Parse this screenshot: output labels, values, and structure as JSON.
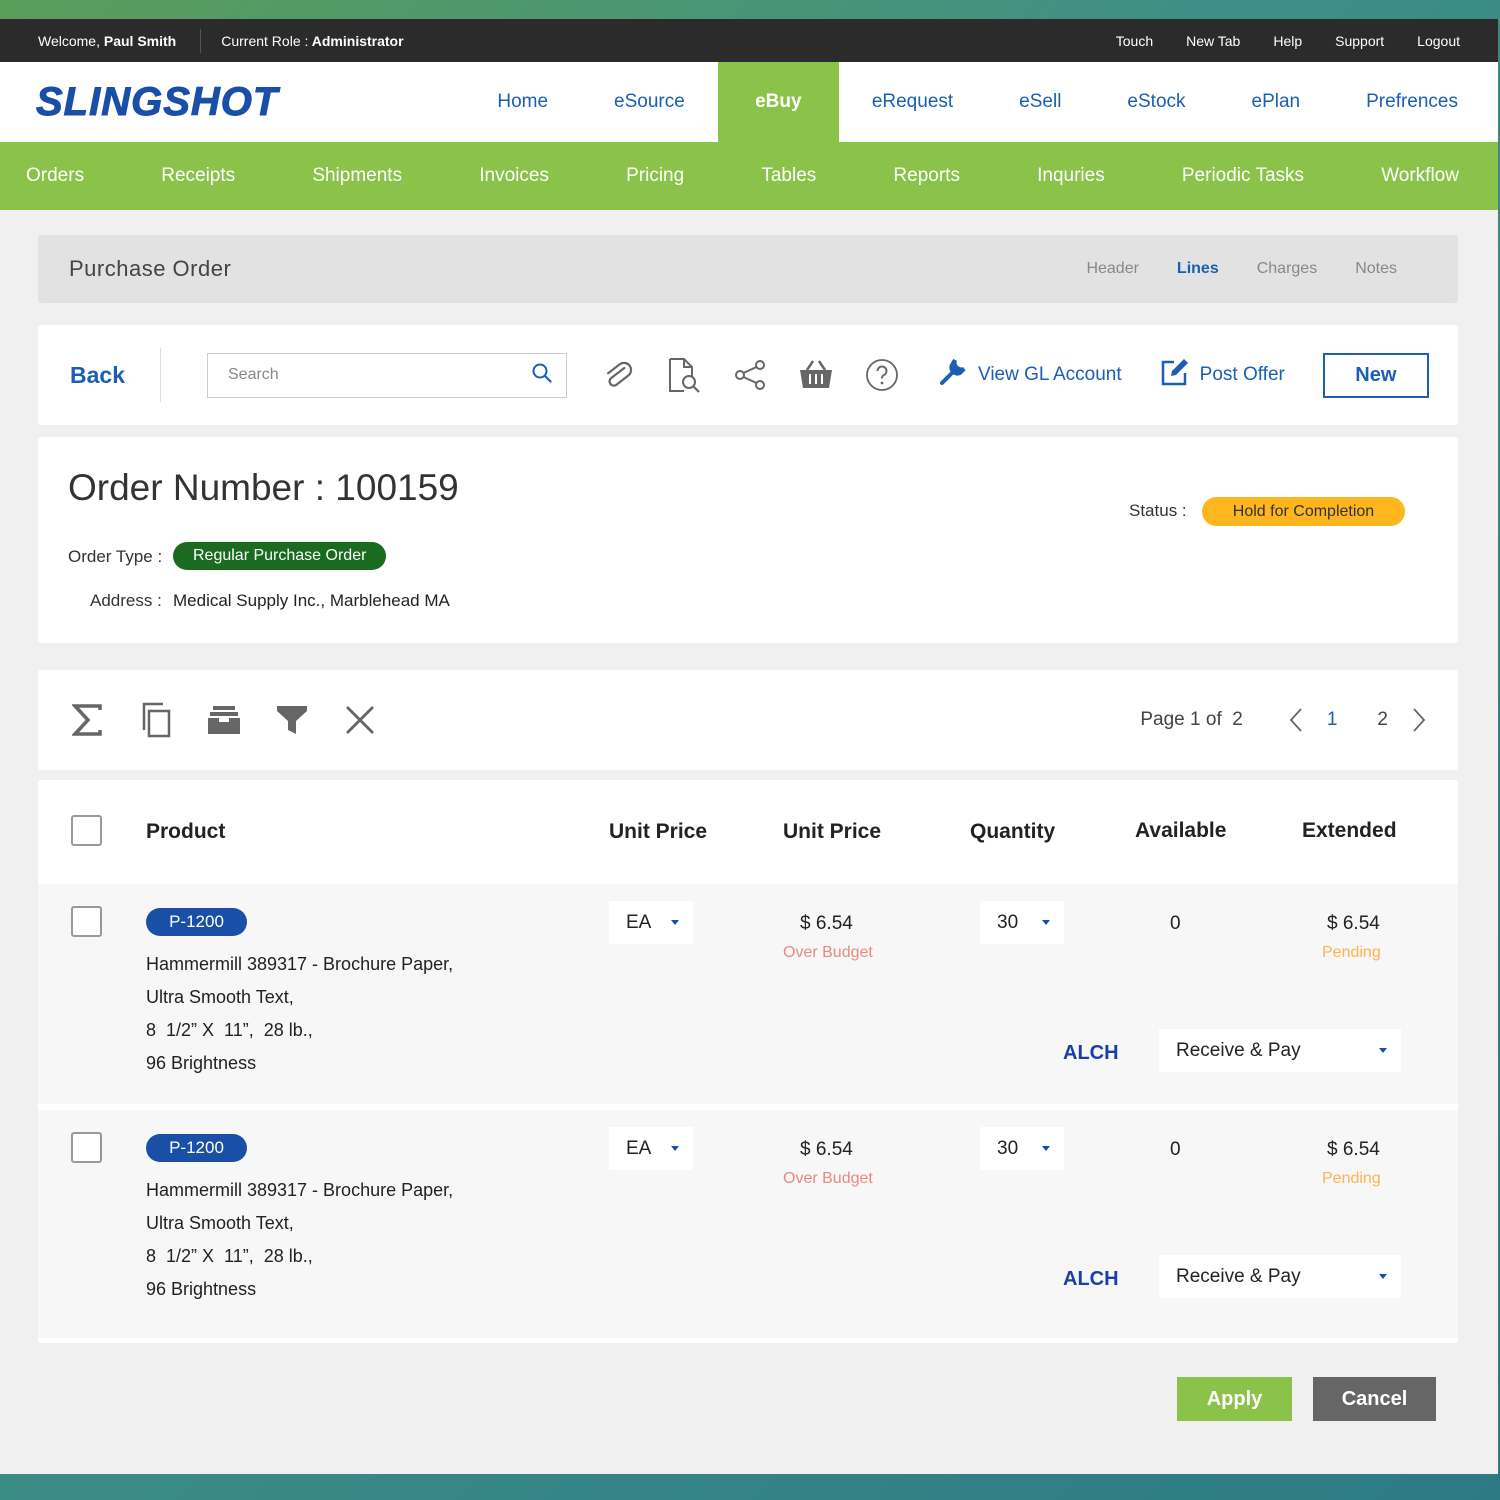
{
  "topbar": {
    "welcome_label": "Welcome,",
    "user_name": "Paul Smith",
    "role_label": "Current Role :",
    "role_value": "Administrator",
    "links": [
      "Touch",
      "New Tab",
      "Help",
      "Support",
      "Logout"
    ]
  },
  "brand": {
    "name": "SLINGSHOT",
    "color": "#1a4fa8"
  },
  "main_nav": {
    "items": [
      "Home",
      "eSource",
      "eBuy",
      "eRequest",
      "eSell",
      "eStock",
      "ePlan",
      "Prefrences"
    ],
    "active": "eBuy"
  },
  "sub_nav": {
    "items": [
      "Orders",
      "Receipts",
      "Shipments",
      "Invoices",
      "Pricing",
      "Tables",
      "Reports",
      "Inquries",
      "Periodic Tasks",
      "Workflow"
    ]
  },
  "page": {
    "title": "Purchase Order",
    "tabs": [
      "Header",
      "Lines",
      "Charges",
      "Notes"
    ],
    "active_tab": "Lines"
  },
  "toolbar": {
    "back_label": "Back",
    "search_placeholder": "Search",
    "icons": [
      "attachment-icon",
      "document-search-icon",
      "share-icon",
      "basket-icon",
      "help-icon"
    ],
    "view_gl_label": "View GL Account",
    "post_offer_label": "Post Offer",
    "new_label": "New"
  },
  "order": {
    "number_label": "Order Number : 100159",
    "type_label": "Order Type :",
    "type_value": "Regular Purchase Order",
    "address_label": "Address :",
    "address_value": "Medical Supply Inc., Marblehead MA",
    "status_label": "Status :",
    "status_value": "Hold for Completion"
  },
  "grid_toolbar": {
    "icons": [
      "sum-icon",
      "copy-icon",
      "archive-icon",
      "filter-icon",
      "close-icon"
    ],
    "page_text": "Page 1 of  2",
    "pages": [
      "1",
      "2"
    ],
    "current_page": "1"
  },
  "table": {
    "headers": [
      "Product",
      "Unit Price",
      "Unit Price",
      "Quantity",
      "Available",
      "Extended"
    ],
    "rows": [
      {
        "sku": "P-1200",
        "desc": [
          "Hammermill 389317 - Brochure Paper,",
          "Ultra Smooth Text,",
          "8  1/2” X  11”,  28 lb.,",
          "96 Brightness"
        ],
        "unit": "EA",
        "price": "$ 6.54",
        "price_note": "Over Budget",
        "qty": "30",
        "available": "0",
        "extended": "$ 6.54",
        "extended_note": "Pending",
        "code": "ALCH",
        "action": "Receive & Pay"
      },
      {
        "sku": "P-1200",
        "desc": [
          "Hammermill 389317 - Brochure Paper,",
          "Ultra Smooth Text,",
          "8  1/2” X  11”,  28 lb.,",
          "96 Brightness"
        ],
        "unit": "EA",
        "price": "$ 6.54",
        "price_note": "Over Budget",
        "qty": "30",
        "available": "0",
        "extended": "$ 6.54",
        "extended_note": "Pending",
        "code": "ALCH",
        "action": "Receive & Pay"
      }
    ]
  },
  "footer": {
    "apply_label": "Apply",
    "cancel_label": "Cancel"
  },
  "colors": {
    "accent_green": "#8bc34a",
    "primary_blue": "#1a5fb4",
    "status_orange": "#ffb51e",
    "type_green": "#1a6b1f"
  }
}
